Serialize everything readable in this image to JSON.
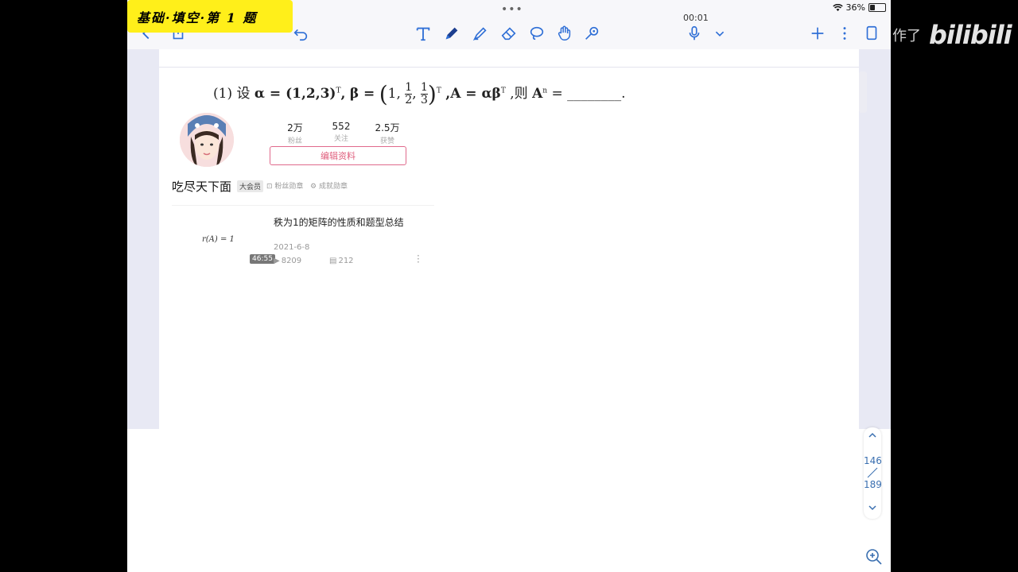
{
  "badge": {
    "text": "基础·填空·第 1 题"
  },
  "status": {
    "timer": "00:01",
    "battery": "36%",
    "battery_fraction": 0.36
  },
  "toolbar": {
    "icons": [
      "back-icon",
      "share-icon",
      "undo-icon",
      "text-tool-icon",
      "pen-tool-icon",
      "highlighter-icon",
      "eraser-icon",
      "lasso-icon",
      "hand-icon",
      "shape-icon",
      "microphone-icon",
      "chevron-down-icon",
      "add-icon",
      "more-icon",
      "pages-icon"
    ],
    "accent_color": "#2f6fd6"
  },
  "problem": {
    "number": "(1)",
    "text_prefix": "设",
    "alpha_def": "α = (1,2,3)",
    "beta_prefix": "β =",
    "beta_first": "1,",
    "frac1": {
      "num": "1",
      "den": "2"
    },
    "frac2": {
      "num": "1",
      "den": "3"
    },
    "T": "T",
    "A_def": ",A = αβ",
    "then": ",则",
    "A_power": "A",
    "power": "n",
    "equals": "=",
    "blank": "________",
    "period": "."
  },
  "profile": {
    "stats": [
      {
        "num": "2万",
        "label": "粉丝"
      },
      {
        "num": "552",
        "label": "关注"
      },
      {
        "num": "2.5万",
        "label": "获赞"
      }
    ],
    "edit_label": "编辑资料",
    "username": "吃尽天下面",
    "vip_label": "大会员",
    "fan_medal": "粉丝勋章",
    "achievement_medal": "成就勋章"
  },
  "video": {
    "title": "秩为1的矩阵的性质和题型总结",
    "thumb_text": "r(A) = 1",
    "duration": "46:55",
    "date": "2021-6-8",
    "views": "8209",
    "comments": "212"
  },
  "pager": {
    "current": "146",
    "total": "189"
  },
  "watermark": {
    "small": "作了",
    "brand": "bilibili"
  }
}
